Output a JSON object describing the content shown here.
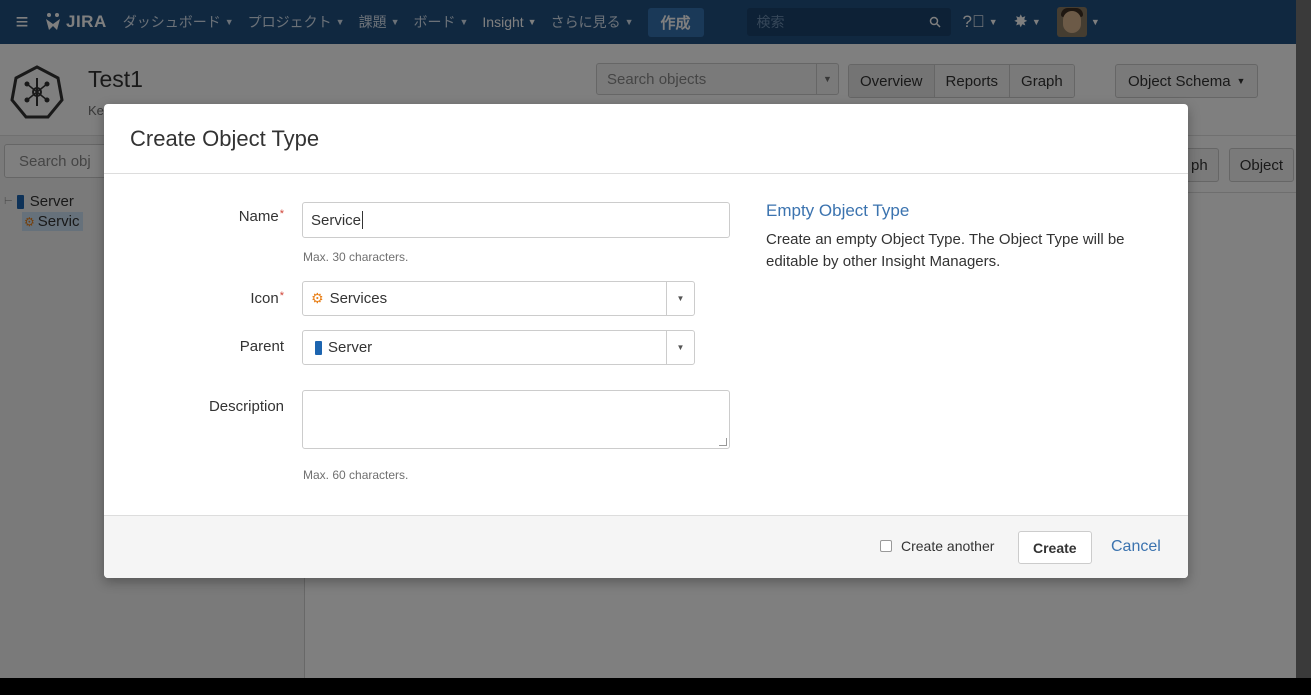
{
  "topbar": {
    "product": "JIRA",
    "nav": [
      {
        "label": "ダッシュボード",
        "active": false
      },
      {
        "label": "プロジェクト",
        "active": false
      },
      {
        "label": "課題",
        "active": false
      },
      {
        "label": "ボード",
        "active": false
      },
      {
        "label": "Insight",
        "active": true
      },
      {
        "label": "さらに見る",
        "active": false
      }
    ],
    "create_label": "作成",
    "search_placeholder": "検索",
    "colors": {
      "bar": "#205081",
      "create": "#3572b0"
    }
  },
  "header": {
    "title": "Test1",
    "key": "Ke",
    "search_placeholder": "Search objects",
    "views": [
      "Overview",
      "Reports",
      "Graph"
    ],
    "schema_button": "Object Schema"
  },
  "left_panel": {
    "search_placeholder": "Search obj",
    "tree": [
      {
        "label": "Server",
        "icon": "server-icon"
      },
      {
        "label": "Servic",
        "icon": "services-icon",
        "selected": true
      }
    ]
  },
  "behind_buttons": [
    "ph",
    "Object"
  ],
  "dialog": {
    "title": "Create Object Type",
    "name_label": "Name",
    "name_value": "Service",
    "name_hint": "Max. 30 characters.",
    "icon_label": "Icon",
    "icon_value": "Services",
    "parent_label": "Parent",
    "parent_value": "Server",
    "description_label": "Description",
    "description_value": "",
    "description_hint": "Max. 60 characters.",
    "side_title": "Empty Object Type",
    "side_text": "Create an empty Object Type. The Object Type will be editable by other Insight Managers.",
    "create_another_label": "Create another",
    "create_another_checked": false,
    "create_button": "Create",
    "cancel_link": "Cancel"
  }
}
